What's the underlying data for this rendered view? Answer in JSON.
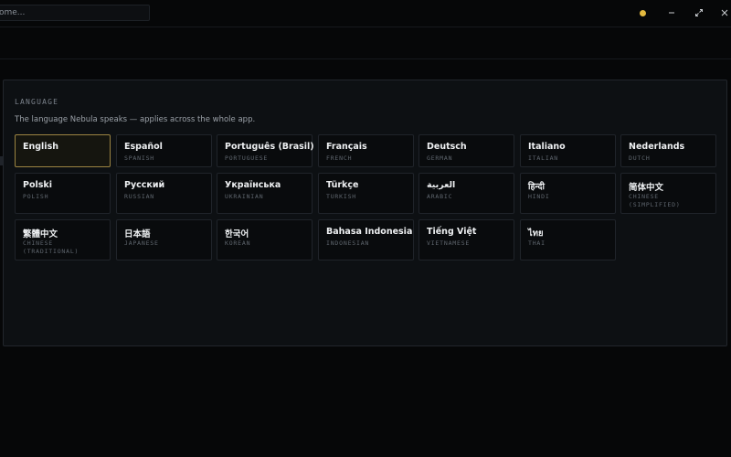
{
  "topbar": {
    "search_placeholder": "ome...",
    "status_color": "#e3b93f",
    "icons": [
      "minimize-icon",
      "maximize-icon",
      "close-icon"
    ]
  },
  "section": {
    "label": "LANGUAGE",
    "description": "The language Nebula speaks — applies across the whole app."
  },
  "languages": [
    {
      "native": "English",
      "english": "",
      "selected": true
    },
    {
      "native": "Español",
      "english": "SPANISH"
    },
    {
      "native": "Português (Brasil)",
      "english": "PORTUGUESE"
    },
    {
      "native": "Français",
      "english": "FRENCH"
    },
    {
      "native": "Deutsch",
      "english": "GERMAN"
    },
    {
      "native": "Italiano",
      "english": "ITALIAN"
    },
    {
      "native": "Nederlands",
      "english": "DUTCH"
    },
    {
      "native": "Polski",
      "english": "POLISH"
    },
    {
      "native": "Русский",
      "english": "RUSSIAN"
    },
    {
      "native": "Українська",
      "english": "UKRAINIAN"
    },
    {
      "native": "Türkçe",
      "english": "TURKISH"
    },
    {
      "native": "العربية",
      "english": "ARABIC"
    },
    {
      "native": "हिन्दी",
      "english": "HINDI"
    },
    {
      "native": "简体中文",
      "english": "CHINESE (SIMPLIFIED)"
    },
    {
      "native": "繁體中文",
      "english": "CHINESE (TRADITIONAL)"
    },
    {
      "native": "日本語",
      "english": "JAPANESE"
    },
    {
      "native": "한국어",
      "english": "KOREAN"
    },
    {
      "native": "Bahasa Indonesia",
      "english": "INDONESIAN"
    },
    {
      "native": "Tiếng Việt",
      "english": "VIETNAMESE"
    },
    {
      "native": "ไทย",
      "english": "THAI"
    }
  ]
}
